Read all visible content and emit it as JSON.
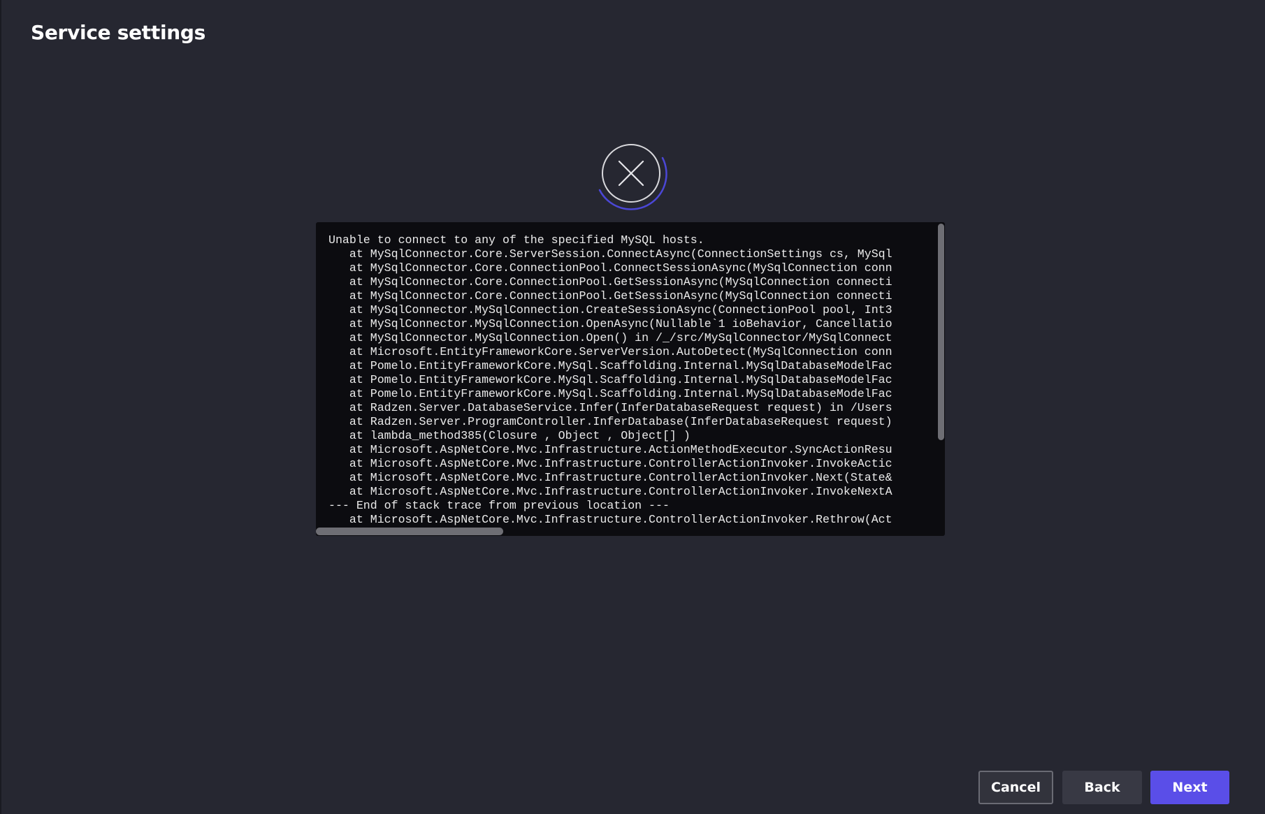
{
  "page": {
    "title": "Service settings"
  },
  "status": {
    "icon": "close-circle-icon",
    "state": "error",
    "accent_color": "#4b47d6"
  },
  "error_log": {
    "lines": [
      "Unable to connect to any of the specified MySQL hosts.",
      "   at MySqlConnector.Core.ServerSession.ConnectAsync(ConnectionSettings cs, MySql",
      "   at MySqlConnector.Core.ConnectionPool.ConnectSessionAsync(MySqlConnection conn",
      "   at MySqlConnector.Core.ConnectionPool.GetSessionAsync(MySqlConnection connecti",
      "   at MySqlConnector.Core.ConnectionPool.GetSessionAsync(MySqlConnection connecti",
      "   at MySqlConnector.MySqlConnection.CreateSessionAsync(ConnectionPool pool, Int3",
      "   at MySqlConnector.MySqlConnection.OpenAsync(Nullable`1 ioBehavior, Cancellatio",
      "   at MySqlConnector.MySqlConnection.Open() in /_/src/MySqlConnector/MySqlConnect",
      "   at Microsoft.EntityFrameworkCore.ServerVersion.AutoDetect(MySqlConnection conn",
      "   at Pomelo.EntityFrameworkCore.MySql.Scaffolding.Internal.MySqlDatabaseModelFac",
      "   at Pomelo.EntityFrameworkCore.MySql.Scaffolding.Internal.MySqlDatabaseModelFac",
      "   at Pomelo.EntityFrameworkCore.MySql.Scaffolding.Internal.MySqlDatabaseModelFac",
      "   at Radzen.Server.DatabaseService.Infer(InferDatabaseRequest request) in /Users",
      "   at Radzen.Server.ProgramController.InferDatabase(InferDatabaseRequest request)",
      "   at lambda_method385(Closure , Object , Object[] )",
      "   at Microsoft.AspNetCore.Mvc.Infrastructure.ActionMethodExecutor.SyncActionResu",
      "   at Microsoft.AspNetCore.Mvc.Infrastructure.ControllerActionInvoker.InvokeActic",
      "   at Microsoft.AspNetCore.Mvc.Infrastructure.ControllerActionInvoker.Next(State&",
      "   at Microsoft.AspNetCore.Mvc.Infrastructure.ControllerActionInvoker.InvokeNextA",
      "--- End of stack trace from previous location ---",
      "   at Microsoft.AspNetCore.Mvc.Infrastructure.ControllerActionInvoker.Rethrow(Act"
    ]
  },
  "actions": {
    "cancel_label": "Cancel",
    "back_label": "Back",
    "next_label": "Next"
  },
  "colors": {
    "background": "#262731",
    "panel": "#0c0c10",
    "primary": "#5a4ee8"
  }
}
